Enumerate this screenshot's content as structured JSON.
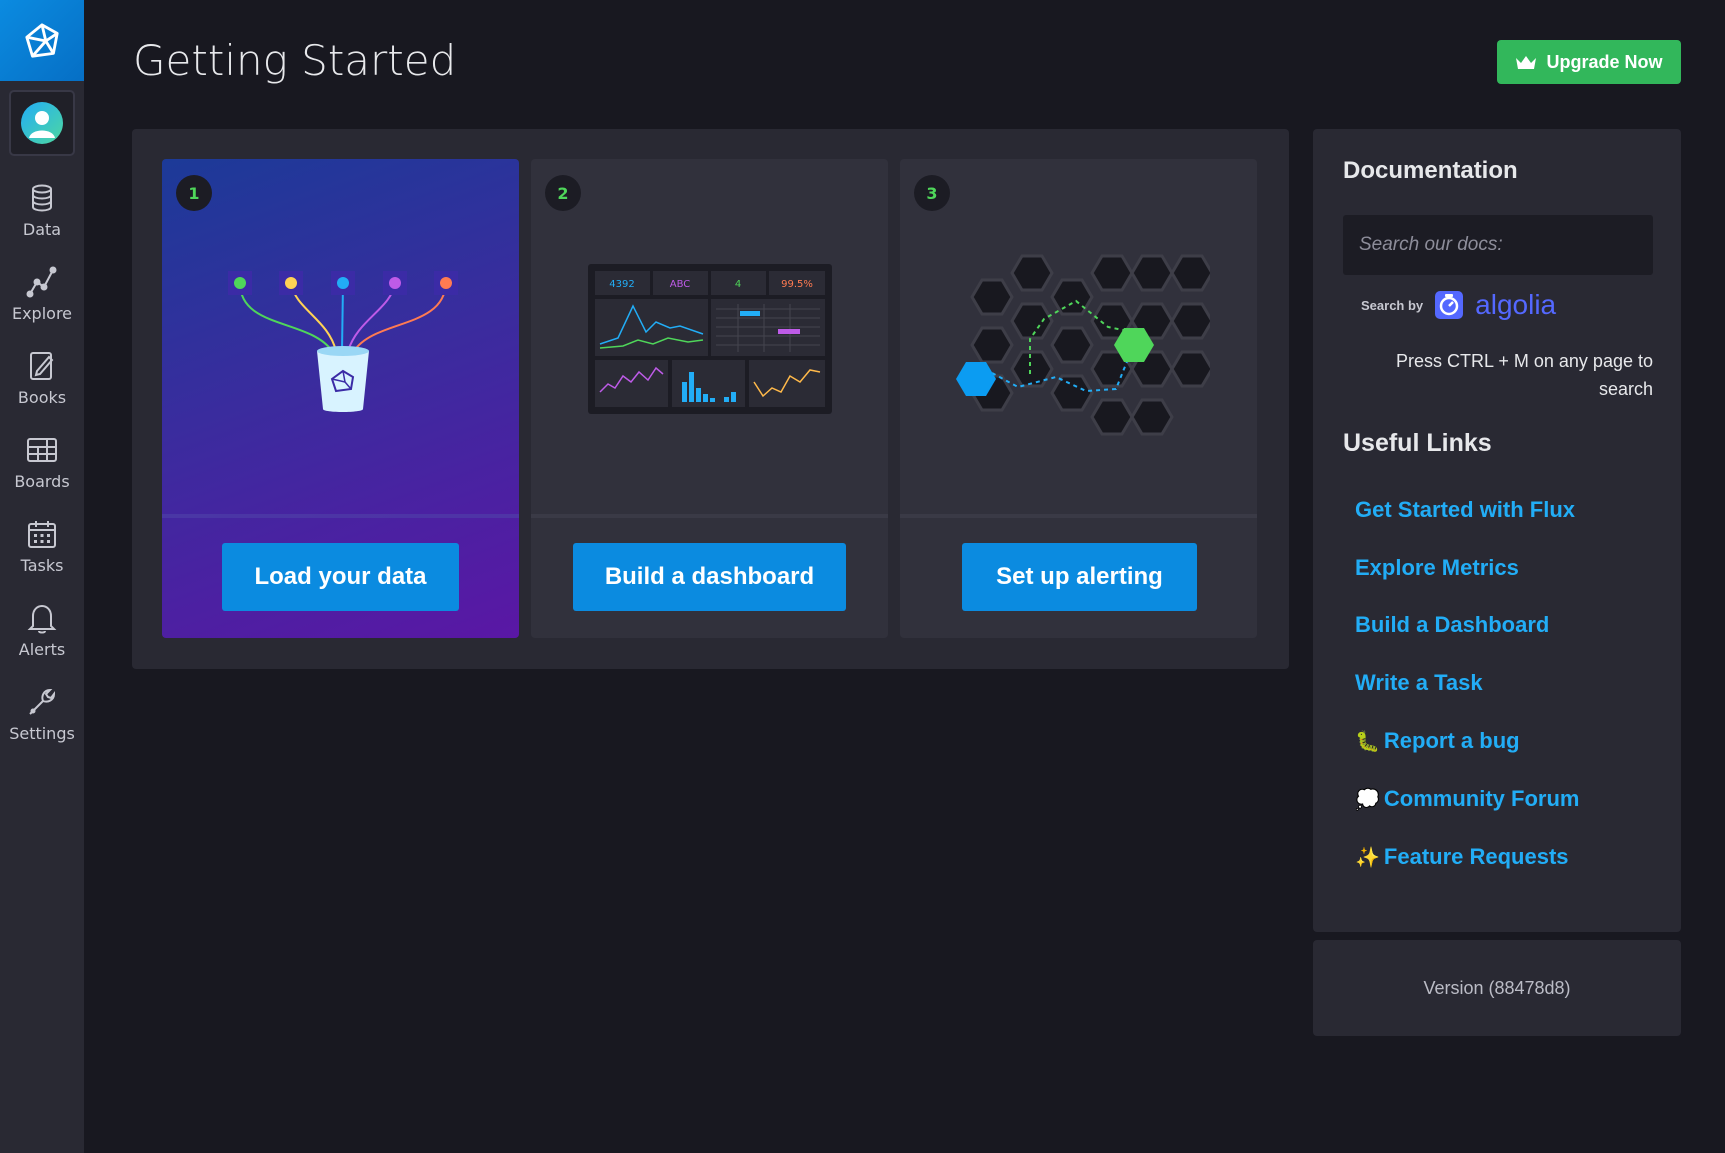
{
  "header": {
    "title": "Getting Started",
    "upgrade_label": "Upgrade Now"
  },
  "sidebar": {
    "items": [
      {
        "label": "Data",
        "icon": "database-icon"
      },
      {
        "label": "Explore",
        "icon": "graph-icon"
      },
      {
        "label": "Books",
        "icon": "notebook-icon"
      },
      {
        "label": "Boards",
        "icon": "dashboard-icon"
      },
      {
        "label": "Tasks",
        "icon": "calendar-icon"
      },
      {
        "label": "Alerts",
        "icon": "bell-icon"
      },
      {
        "label": "Settings",
        "icon": "wrench-icon"
      }
    ]
  },
  "cards": [
    {
      "step": "1",
      "button": "Load your data",
      "active": true
    },
    {
      "step": "2",
      "button": "Build a dashboard",
      "active": false,
      "mini_stats": [
        "4392",
        "ABC",
        "4",
        "99.5%"
      ]
    },
    {
      "step": "3",
      "button": "Set up alerting",
      "active": false
    }
  ],
  "docs": {
    "title": "Documentation",
    "search_placeholder": "Search our docs:",
    "search_by": "Search by",
    "algolia": "algolia",
    "hint": "Press CTRL + M on any page to search",
    "useful_title": "Useful Links",
    "links": [
      {
        "emoji": "",
        "label": "Get Started with Flux"
      },
      {
        "emoji": "",
        "label": "Explore Metrics"
      },
      {
        "emoji": "",
        "label": "Build a Dashboard"
      },
      {
        "emoji": "",
        "label": "Write a Task"
      },
      {
        "emoji": "🐛",
        "label": "Report a bug"
      },
      {
        "emoji": "💭",
        "label": "Community Forum"
      },
      {
        "emoji": "✨",
        "label": "Feature Requests"
      }
    ]
  },
  "version": "Version (88478d8)",
  "colors": {
    "accent": "#0b8be0",
    "success": "#32b75b",
    "link": "#22adf6",
    "background": "#181820",
    "panel": "#292933"
  }
}
